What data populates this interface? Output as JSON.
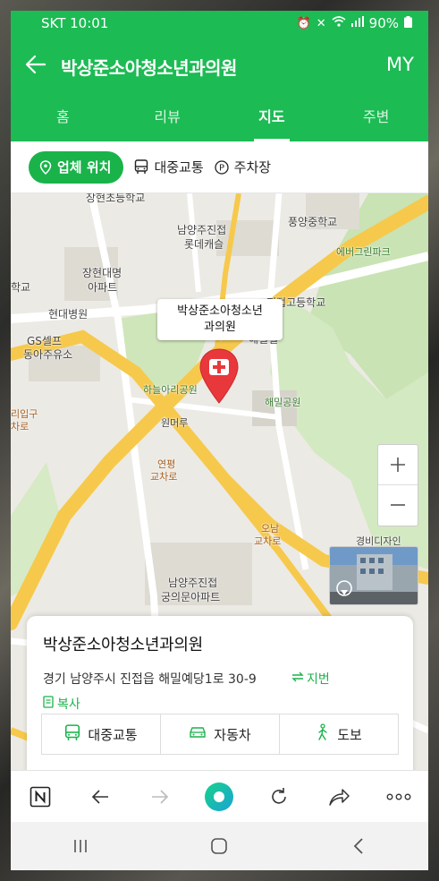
{
  "status_bar": {
    "carrier_time": "SKT 10:01",
    "battery": "90%"
  },
  "header": {
    "title": "박상준소아청소년과의원",
    "my_label": "MY"
  },
  "tabs": [
    {
      "label": "홈",
      "active": false
    },
    {
      "label": "리뷰",
      "active": false
    },
    {
      "label": "지도",
      "active": true
    },
    {
      "label": "주변",
      "active": false
    }
  ],
  "filters": [
    {
      "label": "업체 위치",
      "icon": "location-pin-icon",
      "active": true
    },
    {
      "label": "대중교통",
      "icon": "bus-icon",
      "active": false
    },
    {
      "label": "주차장",
      "icon": "parking-icon",
      "active": false
    }
  ],
  "map": {
    "callout_line1": "박상준소아청소년",
    "callout_line2": "과의원",
    "labels": {
      "school_top": "장현초등학교",
      "apt_namyang": "남양주진접",
      "apt_lotte": "롯데캐슬",
      "pungyang": "풍양중학교",
      "evergreen": "에버그린파크",
      "janghyeon_apt1": "장현대명",
      "janghyeon_apt2": "아파트",
      "hakgyo_left": "학교",
      "hyundai_hosp": "현대병원",
      "gs_self": "GS셀프",
      "dongah": "동아주유소",
      "high_school": "진접고등학교",
      "haemil_vil": "해밀빌",
      "haneul_park": "하늘아리공원",
      "haemil_park": "해밀공원",
      "entrance": "리입구",
      "cha": "차로",
      "wonmeoru": "원머루",
      "yeonpyeong1": "연평",
      "yeonpyeong2": "교차로",
      "onam1": "오남",
      "onam2": "교차로",
      "gungui1": "남양주진접",
      "gungui2": "궁의문아파트",
      "gyeongbi": "경비디자인"
    }
  },
  "place_card": {
    "name": "박상준소아청소년과의원",
    "address": "경기 남양주시 진접읍 해밀예당1로 30-9",
    "jibun_label": "지번",
    "copy_label": "복사",
    "routes": [
      {
        "label": "대중교통",
        "icon": "bus-icon"
      },
      {
        "label": "자동차",
        "icon": "car-icon"
      },
      {
        "label": "도보",
        "icon": "walk-icon"
      }
    ]
  },
  "colors": {
    "brand_green": "#1dbb54",
    "chip_green": "#19b34a",
    "pin_red": "#e8383c",
    "road_yellow": "#f6c94c",
    "park_green": "#c9e3b4"
  }
}
